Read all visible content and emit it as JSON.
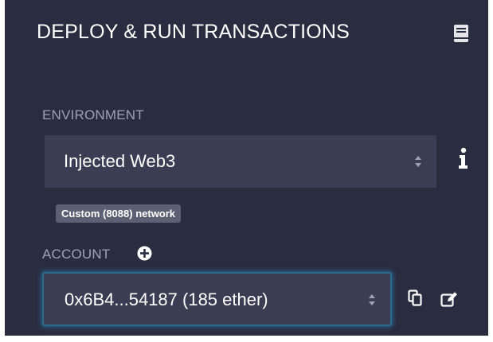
{
  "header": {
    "title": "DEPLOY & RUN TRANSACTIONS",
    "doc_icon": "book-icon"
  },
  "environment": {
    "label": "ENVIRONMENT",
    "selected": "Injected Web3",
    "network_badge": "Custom (8088) network",
    "info_icon": "info-icon"
  },
  "account": {
    "label": "ACCOUNT",
    "selected": "0x6B4...54187 (185 ether)",
    "add_icon": "plus-circle-icon",
    "copy_icon": "copy-icon",
    "edit_icon": "edit-icon"
  },
  "colors": {
    "panel_bg": "#2a2c3f",
    "select_bg": "#3b3e53",
    "label_text": "#9fa2b7",
    "badge_bg": "#5d5f72",
    "focus_ring": "#2b6a8c"
  }
}
